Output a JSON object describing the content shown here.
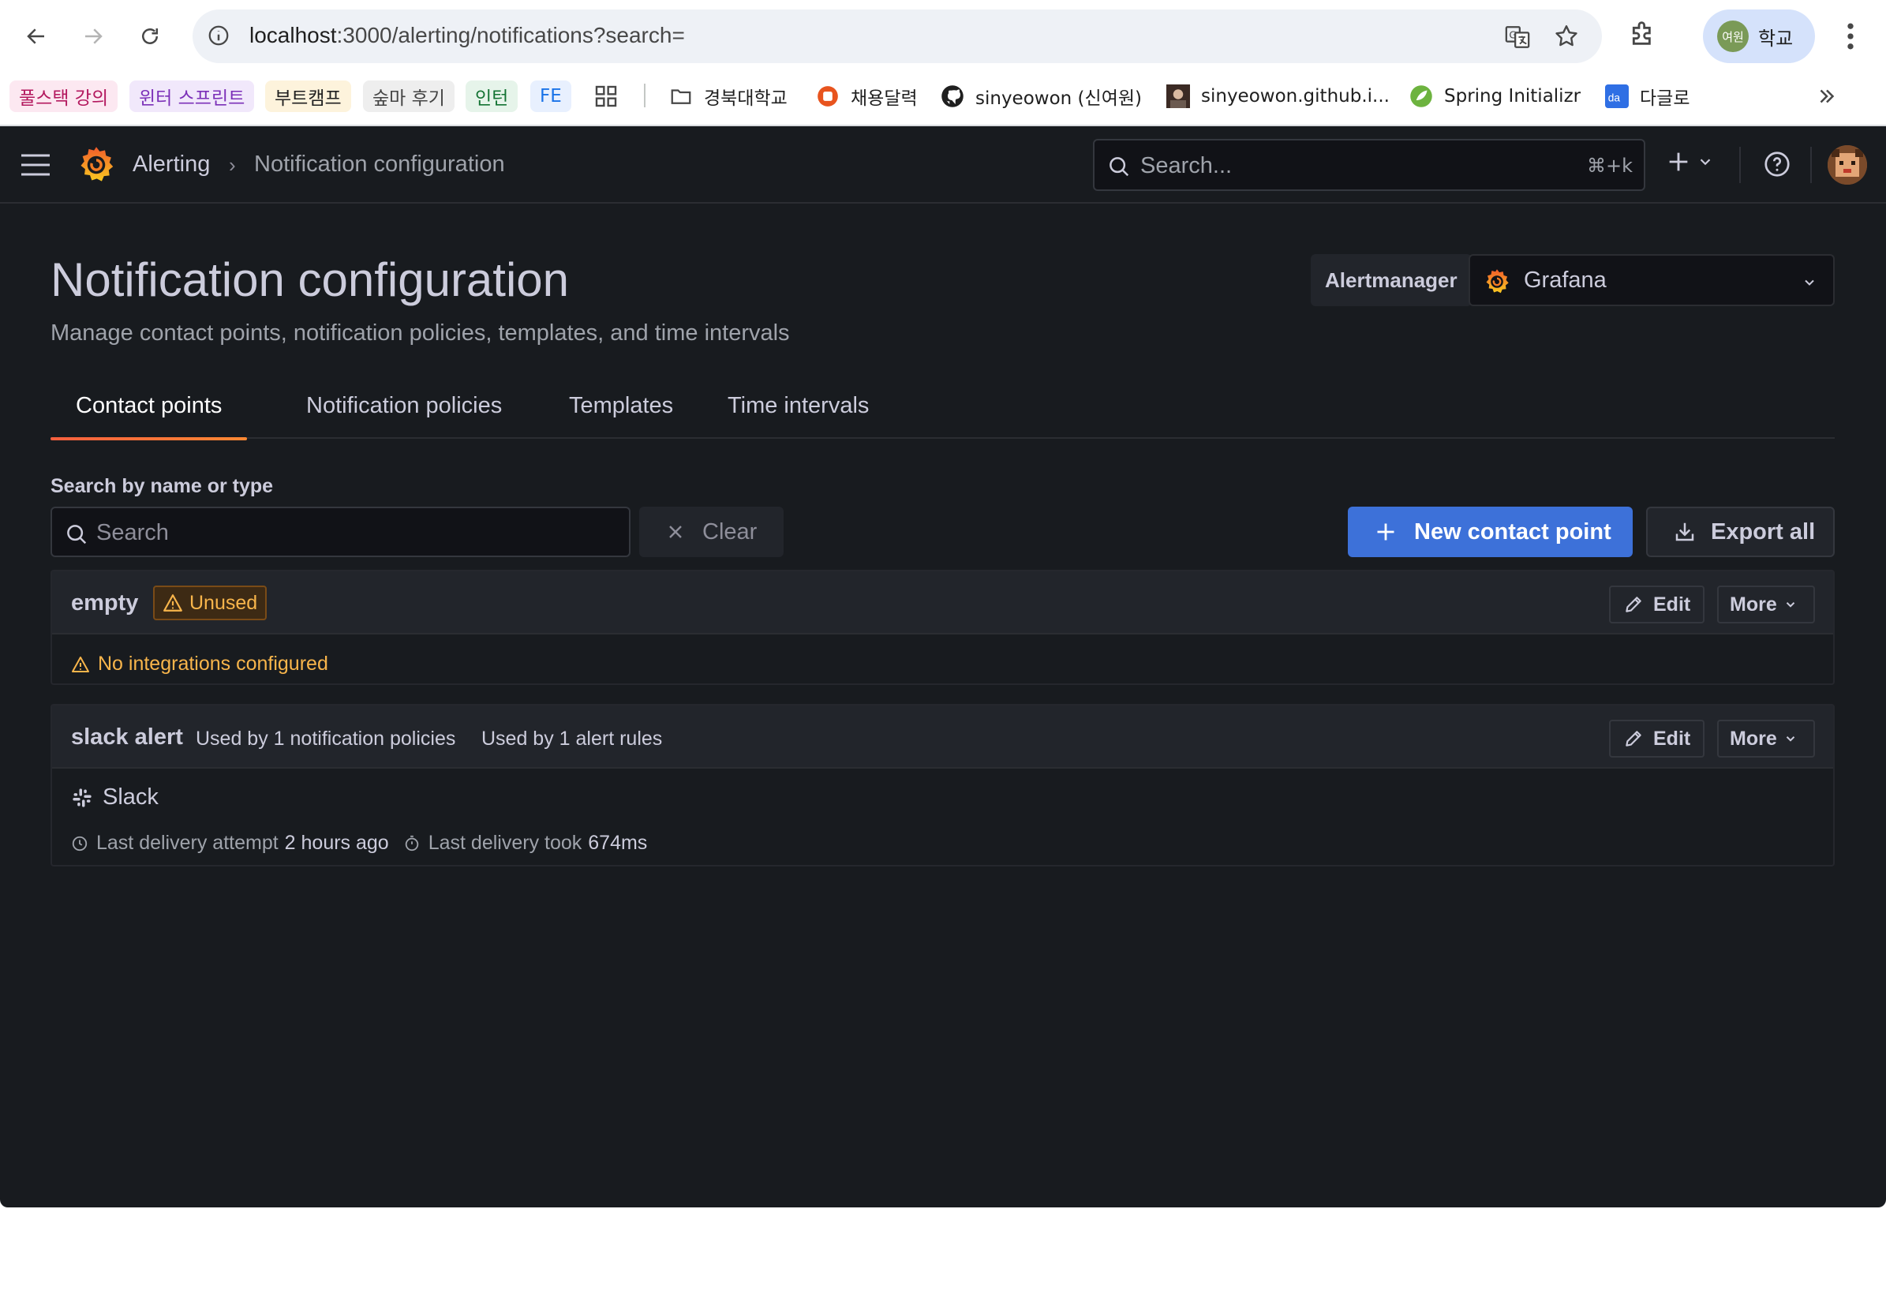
{
  "browser": {
    "url_host": "localhost",
    "url_rest": ":3000/alerting/notifications?search=",
    "profile_avatar_text": "여원",
    "profile_name": "학교",
    "bookmark_chips": [
      {
        "label": "풀스택 강의",
        "bg": "#fce8f1",
        "fg": "#b3185e"
      },
      {
        "label": "윈터 스프린트",
        "bg": "#f1e8fb",
        "fg": "#7b2fb8"
      },
      {
        "label": "부트캠프",
        "bg": "#fdf3dc",
        "fg": "#1f1f1f"
      },
      {
        "label": "숲마 후기",
        "bg": "#eeeeee",
        "fg": "#444444"
      },
      {
        "label": "인턴",
        "bg": "#e6f4ea",
        "fg": "#137333"
      },
      {
        "label": "FE",
        "bg": "#e8f0fe",
        "fg": "#1a73e8"
      }
    ],
    "bookmarks": [
      {
        "label": "경북대학교",
        "icon": "folder-icon"
      },
      {
        "label": "채용달력",
        "icon": "calendar-app-icon"
      },
      {
        "label": "sinyeowon (신여원)",
        "icon": "github-icon"
      },
      {
        "label": "sinyeowon.github.i...",
        "icon": "profile-photo-icon"
      },
      {
        "label": "Spring Initializr",
        "icon": "spring-icon"
      },
      {
        "label": "다글로",
        "icon": "daglo-icon"
      }
    ]
  },
  "grafana": {
    "breadcrumb": {
      "parent": "Alerting",
      "current": "Notification configuration"
    },
    "search_placeholder": "Search...",
    "search_shortcut": "⌘+k",
    "page": {
      "title": "Notification configuration",
      "subtitle": "Manage contact points, notification policies, templates, and time intervals"
    },
    "alertmanager": {
      "label": "Alertmanager",
      "selected": "Grafana"
    },
    "tabs": [
      {
        "label": "Contact points",
        "active": true
      },
      {
        "label": "Notification policies",
        "active": false
      },
      {
        "label": "Templates",
        "active": false
      },
      {
        "label": "Time intervals",
        "active": false
      }
    ],
    "filter": {
      "label": "Search by name or type",
      "placeholder": "Search",
      "clear_label": "Clear"
    },
    "actions": {
      "new_contact_point": "New contact point",
      "export_all": "Export all"
    },
    "contact_points": [
      {
        "name": "empty",
        "badge": "Unused",
        "warning": "No integrations configured",
        "edit": "Edit",
        "more": "More"
      },
      {
        "name": "slack alert",
        "used_policies": "Used by 1 notification policies",
        "used_rules": "Used by 1 alert rules",
        "integration": "Slack",
        "last_attempt_label": "Last delivery attempt",
        "last_attempt_value": "2 hours ago",
        "last_took_label": "Last delivery took",
        "last_took_value": "674ms",
        "edit": "Edit",
        "more": "More"
      }
    ]
  },
  "colors": {
    "primary": "#3d71d9",
    "warning": "#f8b54b",
    "bg": "#181b1f",
    "tab_accent": "#f55f3e"
  }
}
